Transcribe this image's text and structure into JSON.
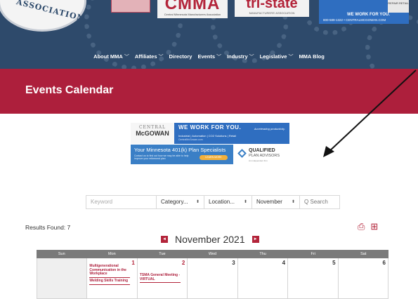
{
  "header": {
    "assoc_text": "ASSOCIATION",
    "cmma": {
      "name": "CMMA",
      "sub": "Central Minnesota Manufacturers Association"
    },
    "tristate": {
      "name": "tri-state",
      "sub": "MANUFACTURERS' ASSOCIATION"
    },
    "ad": {
      "side": "REPAIR RETAIL",
      "headline": "WE WORK FOR YOU.",
      "contact": "800-589-1322 • CENTRALMCGOWAN.COM"
    }
  },
  "nav": {
    "items": [
      {
        "label": "About MMA",
        "has_menu": true
      },
      {
        "label": "Affiliates",
        "has_menu": true
      },
      {
        "label": "Directory",
        "has_menu": false
      },
      {
        "label": "Events",
        "has_menu": true
      },
      {
        "label": "Industry",
        "has_menu": true
      },
      {
        "label": "Legislative",
        "has_menu": true
      },
      {
        "label": "MMA Blog",
        "has_menu": false
      }
    ],
    "chevron": "﹀"
  },
  "page": {
    "title": "Events Calendar"
  },
  "ads": {
    "mcgowan": {
      "logo_top": "CENTRAL",
      "logo_main": "McGOWAN",
      "headline": "WE WORK FOR YOU.",
      "sub": "Industrial | Automation | CO2 Solutions | Retail",
      "url": "CentralMcGowan.com",
      "tagline": "Accelerating productivity."
    },
    "k401": {
      "headline": "Your Minnesota 401(k) Plan Specialists",
      "sub": "Contact us to find out how we may be able to help improve your retirement plan",
      "button": "LEARN MORE",
      "brand_1": "QUALIFIED",
      "brand_2": "PLAN ADVISORS",
      "brand_3": "An independent firm"
    }
  },
  "filters": {
    "keyword_placeholder": "Keyword",
    "category": "Category...",
    "location": "Location...",
    "month": "November",
    "search": "Q Search"
  },
  "results": {
    "label": "Results Found: 7"
  },
  "calendar": {
    "month_title": "November 2021",
    "prev": "◄",
    "next": "►",
    "weekdays": [
      "Sun",
      "Mon",
      "Tue",
      "Wed",
      "Thu",
      "Fri",
      "Sat"
    ],
    "days": [
      "",
      "1",
      "2",
      "3",
      "4",
      "5",
      "6"
    ],
    "events": {
      "mon_1": "Multigenerational Communication in the Workplace",
      "mon_2": "Welding Skills Training",
      "tue_1": "TSMA General Meeting - VIRTUAL"
    }
  },
  "colors": {
    "header_bg": "#2e4a6b",
    "brand_red": "#ad1f3c",
    "weekday_bar": "#7a7a7a"
  }
}
